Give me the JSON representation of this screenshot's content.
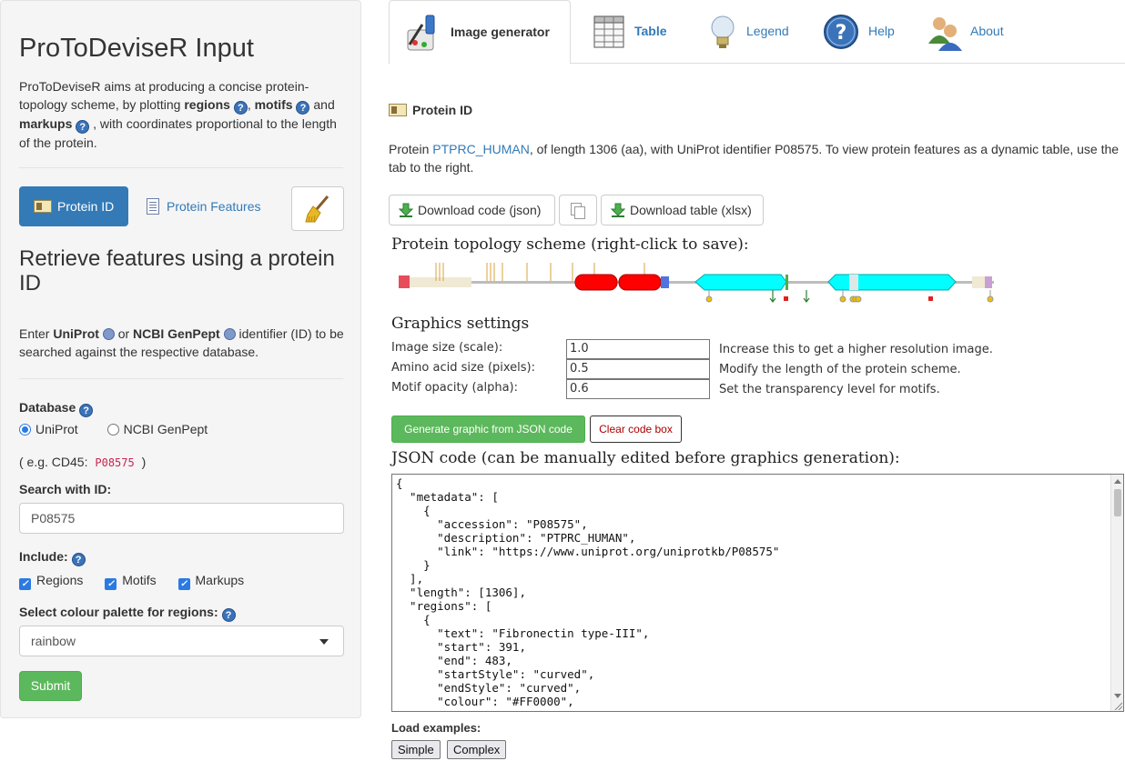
{
  "sidebar": {
    "title": "ProToDeviseR Input",
    "intro": {
      "p1": "ProToDeviseR aims at producing a concise protein-topology scheme, by plotting",
      "regions": "regions",
      "sep1": ",",
      "motifs": "motifs",
      "p2": "and",
      "markups": "markups",
      "p3": ", with coordinates proportional to the length of the protein."
    },
    "tabs": {
      "protein_id": "Protein ID",
      "protein_features": "Protein Features"
    },
    "heading": "Retrieve features using a protein ID",
    "enter": {
      "p1": "Enter",
      "uniprot": "UniProt",
      "or": "or",
      "ncbi": "NCBI GenPept",
      "p2": "identifier (ID) to be searched against the respective database."
    },
    "database_label": "Database",
    "database_options": [
      "UniProt",
      "NCBI GenPept"
    ],
    "example_prefix": "( e.g. CD45:",
    "example_code": "P08575",
    "example_suffix": ")",
    "search_label": "Search with ID:",
    "search_value": "P08575",
    "include_label": "Include:",
    "include_options": [
      "Regions",
      "Motifs",
      "Markups"
    ],
    "palette_label": "Select colour palette for regions:",
    "palette_value": "rainbow",
    "submit": "Submit"
  },
  "tabs": [
    {
      "label": "Image generator",
      "icon": "paint-brush-icon"
    },
    {
      "label": "Table",
      "icon": "table-icon"
    },
    {
      "label": "Legend",
      "icon": "lightbulb-icon"
    },
    {
      "label": "Help",
      "icon": "question-icon"
    },
    {
      "label": "About",
      "icon": "users-icon"
    }
  ],
  "main": {
    "pid_heading": "Protein ID",
    "pid_text": {
      "p1": "Protein",
      "link": "PTPRC_HUMAN",
      "p2": ", of length 1306 (aa), with UniProt identifier P08575. To view protein features as a dynamic table, use the tab to the right."
    },
    "download_json": "Download code (json)",
    "download_xlsx": "Download table (xlsx)",
    "scheme_title": "Protein topology scheme (right-click to save):",
    "graphics_title": "Graphics settings",
    "settings": [
      {
        "label": "Image size (scale):",
        "value": "1.0",
        "help": "Increase this to get a higher resolution image."
      },
      {
        "label": "Amino acid size (pixels):",
        "value": "0.5",
        "help": "Modify the length of the protein scheme."
      },
      {
        "label": "Motif opacity (alpha):",
        "value": "0.6",
        "help": "Set the transparency level for motifs."
      }
    ],
    "generate_btn": "Generate graphic from JSON code",
    "clear_btn": "Clear code box",
    "json_title": "JSON code (can be manually edited before graphics generation):",
    "load_label": "Load examples:",
    "examples": [
      "Simple",
      "Complex"
    ]
  },
  "code_lines": [
    "{",
    "  \"metadata\": [",
    "    {",
    "      \"accession\": \"P08575\",",
    "      \"description\": \"PTPRC_HUMAN\",",
    "      \"link\": \"https://www.uniprot.org/uniprotkb/P08575\"",
    "    }",
    "  ],",
    "  \"length\": [1306],",
    "  \"regions\": [",
    "    {",
    "      \"text\": \"Fibronectin type-III\",",
    "      \"start\": 391,",
    "      \"end\": 483,",
    "      \"startStyle\": \"curved\",",
    "      \"endStyle\": \"curved\",",
    "      \"colour\": \"#FF0000\","
  ],
  "colors": {
    "primary": "#337ab7",
    "success": "#5cb85c",
    "region_red": "#ff0000",
    "region_cyan": "#00ffff"
  }
}
